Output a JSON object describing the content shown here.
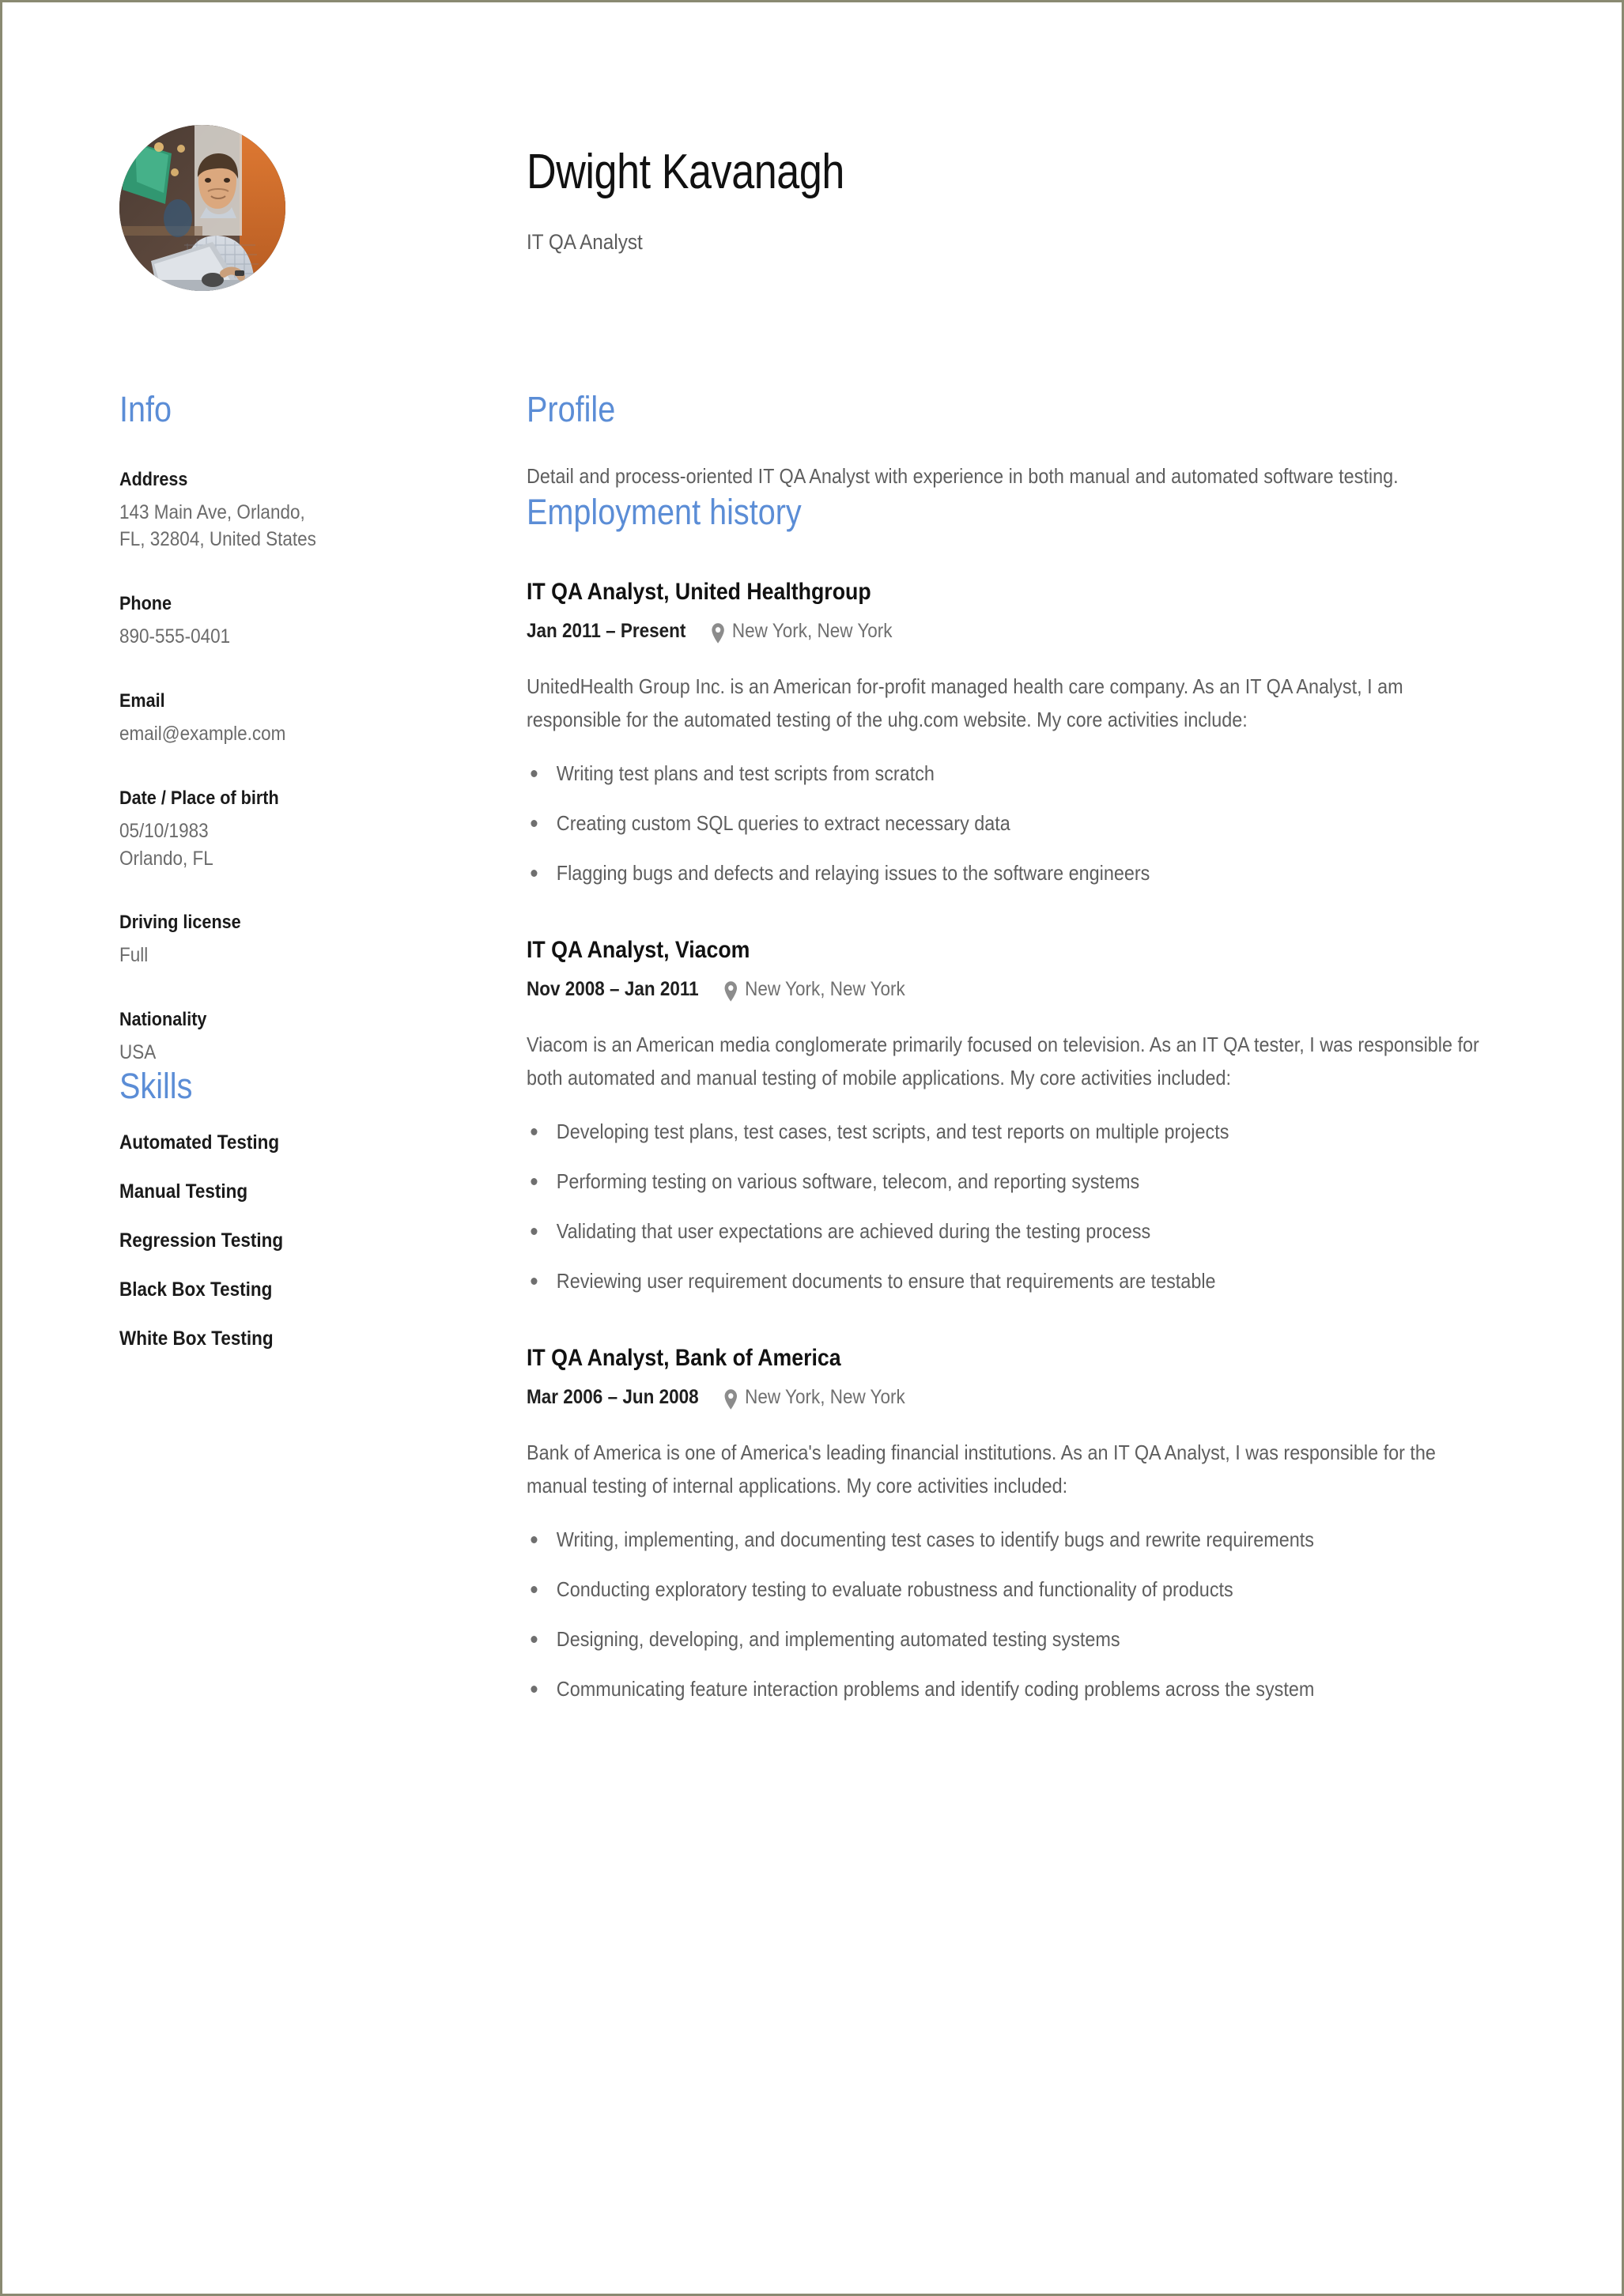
{
  "theme": {
    "accent": "#5b8dd6",
    "heading_text": "#111111",
    "body_text": "#5e5e5e",
    "label_text": "#1a1a1a",
    "page_border": "#8a8a72"
  },
  "header": {
    "name": "Dwight Kavanagh",
    "job_title": "IT QA Analyst",
    "avatar_alt": "portrait-photo"
  },
  "sidebar": {
    "info_heading": "Info",
    "info_items": [
      {
        "label": "Address",
        "value": "143 Main Ave, Orlando,\nFL, 32804, United States"
      },
      {
        "label": "Phone",
        "value": "890-555-0401"
      },
      {
        "label": "Email",
        "value": "email@example.com"
      },
      {
        "label": "Date / Place of birth",
        "value": "05/10/1983\nOrlando, FL"
      },
      {
        "label": "Driving license",
        "value": "Full"
      },
      {
        "label": "Nationality",
        "value": "USA"
      }
    ],
    "skills_heading": "Skills",
    "skills": [
      "Automated Testing",
      "Manual Testing",
      "Regression Testing",
      "Black Box Testing",
      "White Box Testing"
    ]
  },
  "main": {
    "profile_heading": "Profile",
    "profile_text": "Detail and process-oriented IT QA Analyst with experience in both manual and automated software testing.",
    "employment_heading": "Employment history",
    "jobs": [
      {
        "heading": "IT QA Analyst, United Healthgroup",
        "dates": "Jan 2011 – Present",
        "location": "New York, New York",
        "location_icon": "map-pin-icon",
        "description": "UnitedHealth Group Inc. is an American for-profit managed health care company. As an IT QA Analyst, I am responsible for the automated testing of the uhg.com website. My core activities include:",
        "bullets": [
          "Writing test plans and test scripts from scratch",
          "Creating custom SQL queries to extract necessary data",
          "Flagging bugs and defects and relaying issues to the software engineers"
        ]
      },
      {
        "heading": "IT QA Analyst, Viacom",
        "dates": "Nov 2008 – Jan 2011",
        "location": "New York, New York",
        "location_icon": "map-pin-icon",
        "description": "Viacom is an American media conglomerate primarily focused on television. As an IT QA tester, I was responsible for both automated and manual testing of mobile applications. My core activities included:",
        "bullets": [
          "Developing test plans, test cases, test scripts, and test reports on multiple projects",
          "Performing testing on various software, telecom, and reporting systems",
          "Validating that user expectations are achieved during the testing process",
          "Reviewing user requirement documents to ensure that requirements are testable"
        ]
      },
      {
        "heading": "IT QA Analyst, Bank of America",
        "dates": "Mar 2006 – Jun 2008",
        "location": "New York, New York",
        "location_icon": "map-pin-icon",
        "description": "Bank of America is one of America's leading financial institutions. As an IT QA Analyst, I was responsible for the manual testing of internal applications. My core activities included:",
        "bullets": [
          "Writing, implementing, and documenting test cases to identify bugs and rewrite requirements",
          "Conducting exploratory testing to evaluate robustness and functionality of products",
          "Designing, developing, and implementing automated testing systems",
          "Communicating feature interaction problems and identify coding problems across the system"
        ]
      }
    ]
  }
}
